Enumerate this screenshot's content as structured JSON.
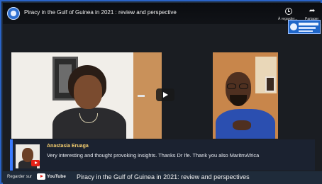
{
  "header": {
    "title": "Piracy in the Gulf of Guinea in 2021 : review and perspective",
    "watch_later_label": "À regarder...",
    "share_label": "Partager",
    "channel_avatar_icon": "channel-avatar-icon",
    "brand_logo_icon": "maritime-africa-logo-icon"
  },
  "video": {
    "play_icon": "play-icon",
    "left_participant": "woman-in-black-on-video-call",
    "right_participant": "man-in-blue-on-video-call"
  },
  "comment": {
    "author": "Anastasia Eruaga",
    "text": "Very interesting and thought provoking insights. Thanks Dr Ife. Thank you also MaritmAfrica",
    "source_icon": "youtube-icon"
  },
  "footer": {
    "watch_on": "Regarder sur",
    "youtube_word": "YouTube",
    "caption": "Piracy in the Gulf of Guinea in 2021: review and perspectives"
  },
  "colors": {
    "frame_border": "#2a64c8",
    "comment_accent": "#3b7bff",
    "author_color": "#f7d070",
    "youtube_red": "#e62117"
  }
}
